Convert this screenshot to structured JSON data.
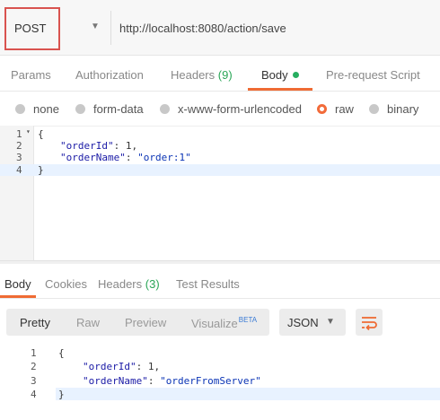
{
  "request": {
    "method": "POST",
    "url": "http://localhost:8080/action/save"
  },
  "request_tabs": {
    "params": "Params",
    "authorization": "Authorization",
    "headers": "Headers",
    "headers_count": "(9)",
    "body": "Body",
    "prerequest": "Pre-request Script"
  },
  "body_types": {
    "none": "none",
    "form_data": "form-data",
    "urlencoded": "x-www-form-urlencoded",
    "raw": "raw",
    "binary": "binary",
    "selected": "raw"
  },
  "request_editor": {
    "line_numbers": [
      "1",
      "2",
      "3",
      "4"
    ],
    "l1": "{",
    "l2_key": "\"orderId\"",
    "l2_colon": ": ",
    "l2_val": "1,",
    "l3_key": "\"orderName\"",
    "l3_colon": ": ",
    "l3_val": "\"order:1\"",
    "l4": "}"
  },
  "response_tabs": {
    "body": "Body",
    "cookies": "Cookies",
    "headers": "Headers",
    "headers_count": "(3)",
    "test_results": "Test Results"
  },
  "response_view": {
    "pretty": "Pretty",
    "raw": "Raw",
    "preview": "Preview",
    "visualize": "Visualize",
    "beta": "BETA",
    "format": "JSON"
  },
  "response_body": {
    "line_numbers": [
      "1",
      "2",
      "3",
      "4"
    ],
    "l1": "{",
    "l2_key": "\"orderId\"",
    "l2_colon": ": ",
    "l2_val": "1,",
    "l3_key": "\"orderName\"",
    "l3_colon": ": ",
    "l3_val": "\"orderFromServer\"",
    "l4": "}"
  },
  "colors": {
    "accent": "#ef6b34",
    "highlight_box": "#d9534f",
    "active_dot": "#27ae60",
    "json_key": "#1a1aa6",
    "json_string": "#0b34b5"
  }
}
